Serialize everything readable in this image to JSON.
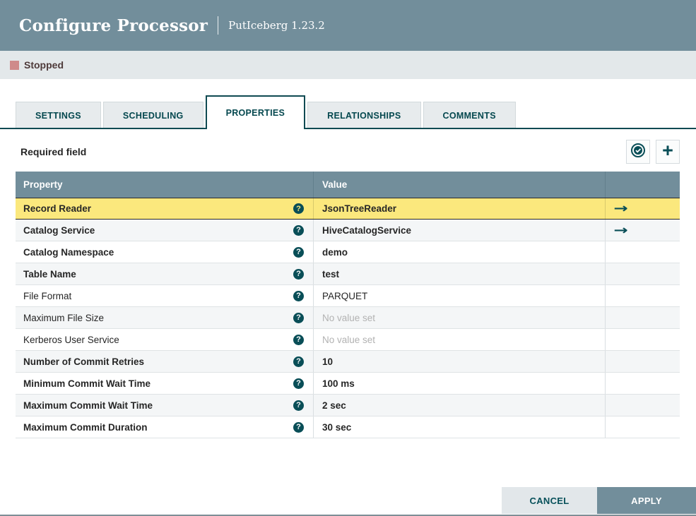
{
  "dialog": {
    "title": "Configure Processor",
    "subtitle": "PutIceberg 1.23.2",
    "status": "Stopped"
  },
  "tabs": [
    {
      "label": "SETTINGS",
      "active": false
    },
    {
      "label": "SCHEDULING",
      "active": false
    },
    {
      "label": "PROPERTIES",
      "active": true
    },
    {
      "label": "RELATIONSHIPS",
      "active": false
    },
    {
      "label": "COMMENTS",
      "active": false
    }
  ],
  "properties_panel": {
    "required_label": "Required field",
    "toolbar": {
      "verify_button": "verify-properties",
      "add_button": "add-property"
    },
    "columns": {
      "property": "Property",
      "value": "Value"
    },
    "rows": [
      {
        "property": "Record Reader",
        "value": "JsonTreeReader",
        "required": true,
        "selected": true,
        "goto": true,
        "unset": false
      },
      {
        "property": "Catalog Service",
        "value": "HiveCatalogService",
        "required": true,
        "selected": false,
        "goto": true,
        "unset": false
      },
      {
        "property": "Catalog Namespace",
        "value": "demo",
        "required": true,
        "selected": false,
        "goto": false,
        "unset": false
      },
      {
        "property": "Table Name",
        "value": "test",
        "required": true,
        "selected": false,
        "goto": false,
        "unset": false
      },
      {
        "property": "File Format",
        "value": "PARQUET",
        "required": false,
        "selected": false,
        "goto": false,
        "unset": false
      },
      {
        "property": "Maximum File Size",
        "value": "No value set",
        "required": false,
        "selected": false,
        "goto": false,
        "unset": true
      },
      {
        "property": "Kerberos User Service",
        "value": "No value set",
        "required": false,
        "selected": false,
        "goto": false,
        "unset": true
      },
      {
        "property": "Number of Commit Retries",
        "value": "10",
        "required": true,
        "selected": false,
        "goto": false,
        "unset": false
      },
      {
        "property": "Minimum Commit Wait Time",
        "value": "100 ms",
        "required": true,
        "selected": false,
        "goto": false,
        "unset": false
      },
      {
        "property": "Maximum Commit Wait Time",
        "value": "2 sec",
        "required": true,
        "selected": false,
        "goto": false,
        "unset": false
      },
      {
        "property": "Maximum Commit Duration",
        "value": "30 sec",
        "required": true,
        "selected": false,
        "goto": false,
        "unset": false
      }
    ]
  },
  "footer": {
    "cancel_label": "CANCEL",
    "apply_label": "APPLY"
  },
  "icons": {
    "help_glyph": "?",
    "goto_glyph": "→",
    "add_glyph": "+"
  },
  "colors": {
    "header_slate": "#728e9b",
    "accent_teal": "#094e57",
    "tab_border": "#0f4a52",
    "selected_row_yellow": "#fbe87d",
    "alt_row_gray": "#f4f6f7",
    "status_bar_bg": "#e3e8ea",
    "stopped_red": "#cf8a8a",
    "unset_text_gray": "#b2b2b2"
  }
}
